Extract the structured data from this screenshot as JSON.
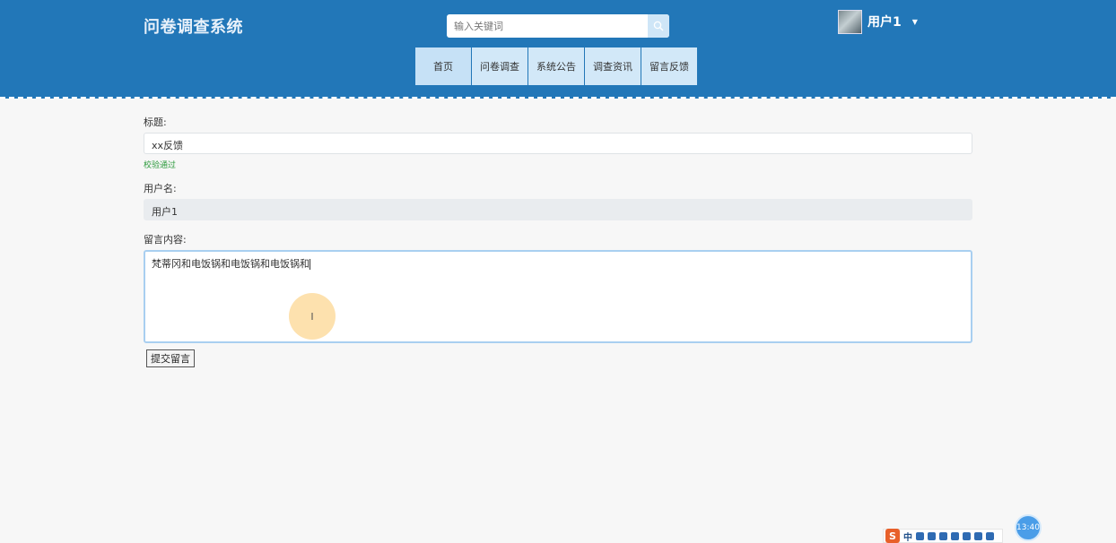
{
  "header": {
    "title": "问卷调查系统",
    "search": {
      "placeholder": "输入关键词"
    },
    "user": {
      "name": "用户1"
    }
  },
  "nav": [
    {
      "label": "首页"
    },
    {
      "label": "问卷调查"
    },
    {
      "label": "系统公告"
    },
    {
      "label": "调查资讯"
    },
    {
      "label": "留言反馈"
    }
  ],
  "form": {
    "title_label": "标题:",
    "title_value": "xx反馈",
    "title_valid": "校验通过",
    "username_label": "用户名:",
    "username_value": "用户1",
    "content_label": "留言内容:",
    "content_value": "梵蒂冈和电饭锅和电饭锅和电饭锅和",
    "submit_label": "提交留言"
  },
  "taskbar": {
    "ime_logo": "S",
    "ime_mode": "中",
    "clock": "13:40"
  },
  "colors": {
    "header_bg": "#2277b8",
    "nav_bg": "#d2e8f8",
    "valid_text": "#2e9b3e"
  }
}
